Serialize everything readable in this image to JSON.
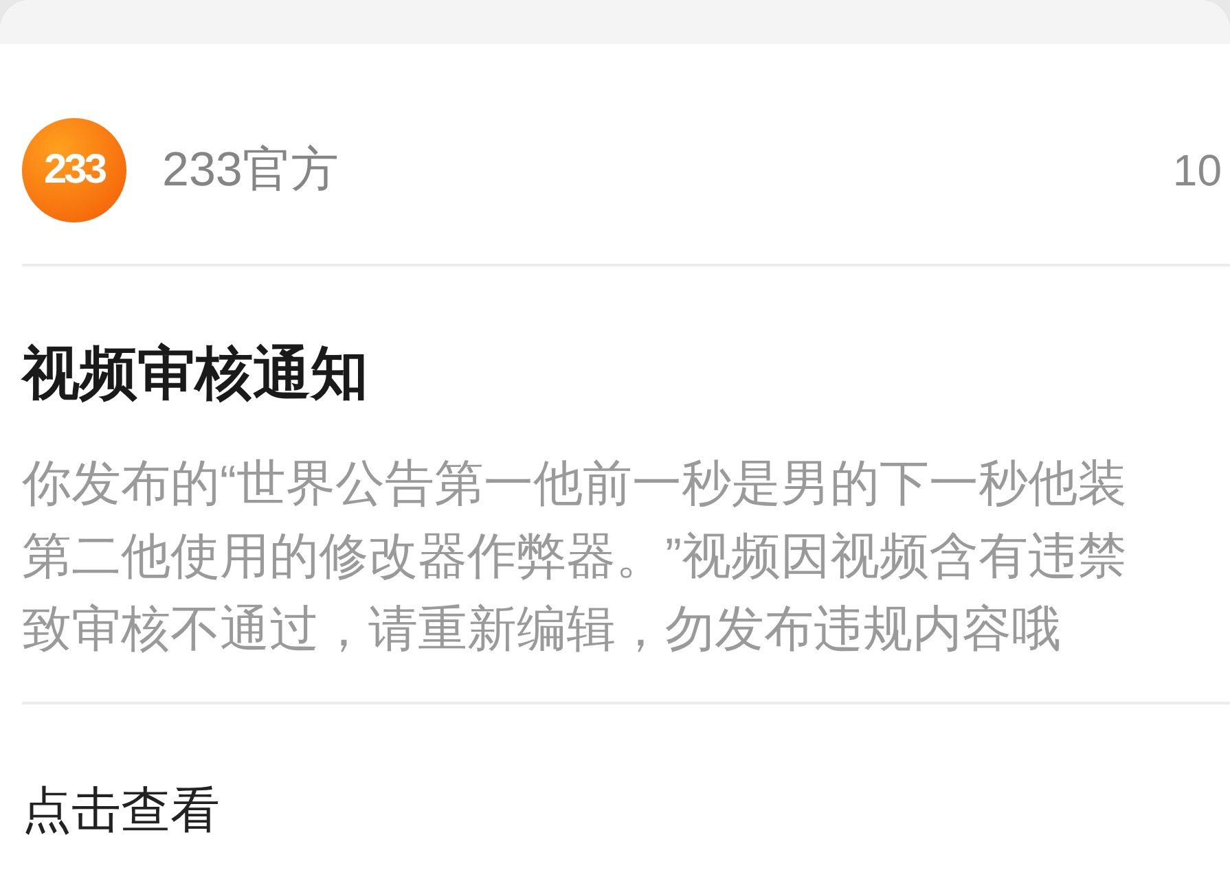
{
  "sender": {
    "avatar_text": "233",
    "name": "233官方",
    "time": "10"
  },
  "notice": {
    "title": "视频审核通知",
    "message_lines": [
      "你发布的“世界公告第一他前一秒是男的下一秒他装",
      "第二他使用的修改器作弊器。”视频因视频含有违禁",
      "致审核不通过，请重新编辑，勿发布违规内容哦"
    ]
  },
  "action": {
    "label": "点击查看"
  }
}
